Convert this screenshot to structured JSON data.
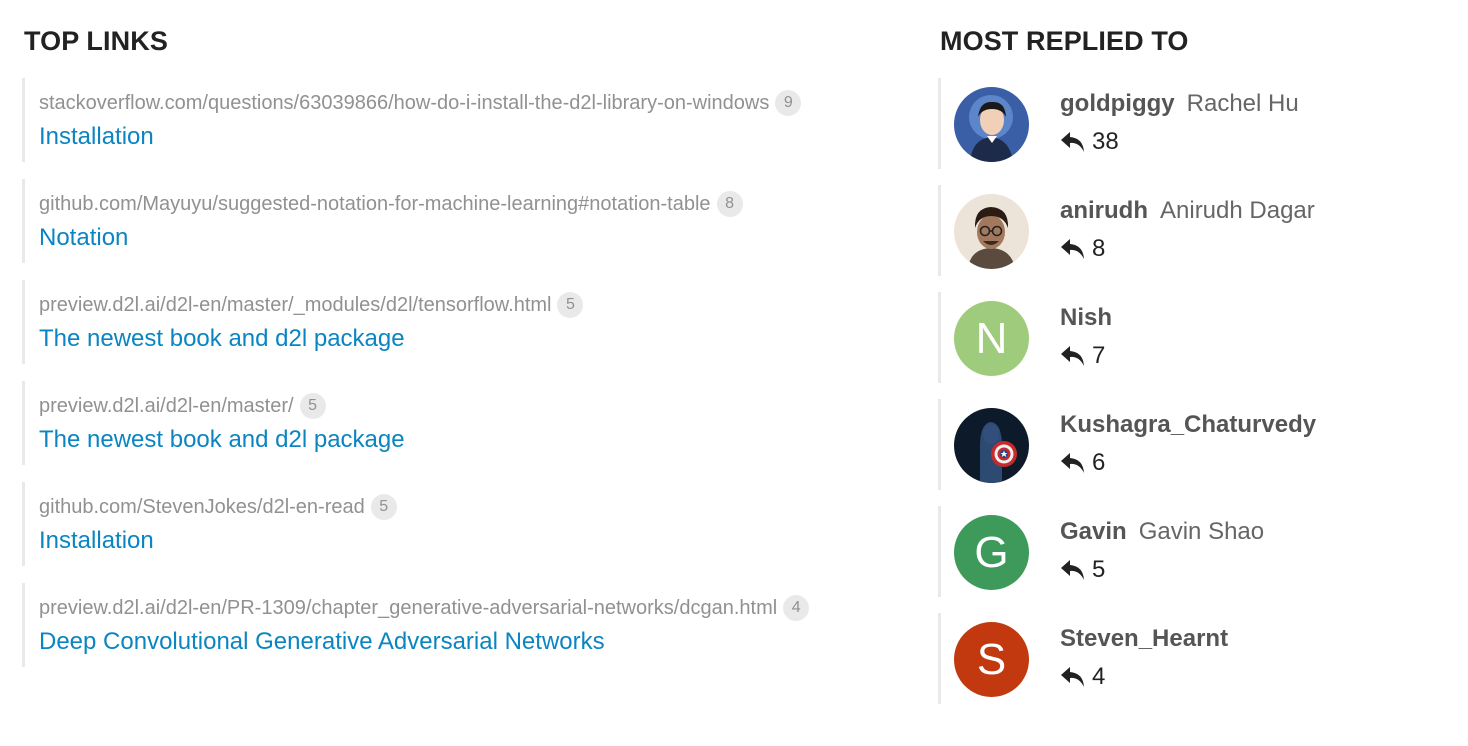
{
  "top_links": {
    "title": "TOP LINKS",
    "items": [
      {
        "url": "stackoverflow.com/questions/63039866/how-do-i-install-the-d2l-library-on-windows",
        "count": "9",
        "title": "Installation"
      },
      {
        "url": "github.com/Mayuyu/suggested-notation-for-machine-learning#notation-table",
        "count": "8",
        "title": "Notation"
      },
      {
        "url": "preview.d2l.ai/d2l-en/master/_modules/d2l/tensorflow.html",
        "count": "5",
        "title": "The newest book and d2l package"
      },
      {
        "url": "preview.d2l.ai/d2l-en/master/",
        "count": "5",
        "title": "The newest book and d2l package"
      },
      {
        "url": "github.com/StevenJokes/d2l-en-read",
        "count": "5",
        "title": "Installation"
      },
      {
        "url": "preview.d2l.ai/d2l-en/PR-1309/chapter_generative-adversarial-networks/dcgan.html",
        "count": "4",
        "title": "Deep Convolutional Generative Adversarial Networks"
      }
    ]
  },
  "most_replied": {
    "title": "MOST REPLIED TO",
    "users": [
      {
        "username": "goldpiggy",
        "name": "Rachel Hu",
        "replies": "38",
        "avatar": "photo-woman",
        "avatar_color": "#2f4f8f"
      },
      {
        "username": "anirudh",
        "name": "Anirudh Dagar",
        "replies": "8",
        "avatar": "photo-man",
        "avatar_color": "#8a6a55"
      },
      {
        "username": "Nish",
        "name": "",
        "replies": "7",
        "avatar": "N",
        "avatar_color": "#9fcb7d"
      },
      {
        "username": "Kushagra_Chaturvedy",
        "name": "",
        "replies": "6",
        "avatar": "photo-captain-america",
        "avatar_color": "#0d1a2a"
      },
      {
        "username": "Gavin",
        "name": "Gavin Shao",
        "replies": "5",
        "avatar": "G",
        "avatar_color": "#3e9a5a"
      },
      {
        "username": "Steven_Hearnt",
        "name": "",
        "replies": "4",
        "avatar": "S",
        "avatar_color": "#c2390f"
      }
    ]
  }
}
